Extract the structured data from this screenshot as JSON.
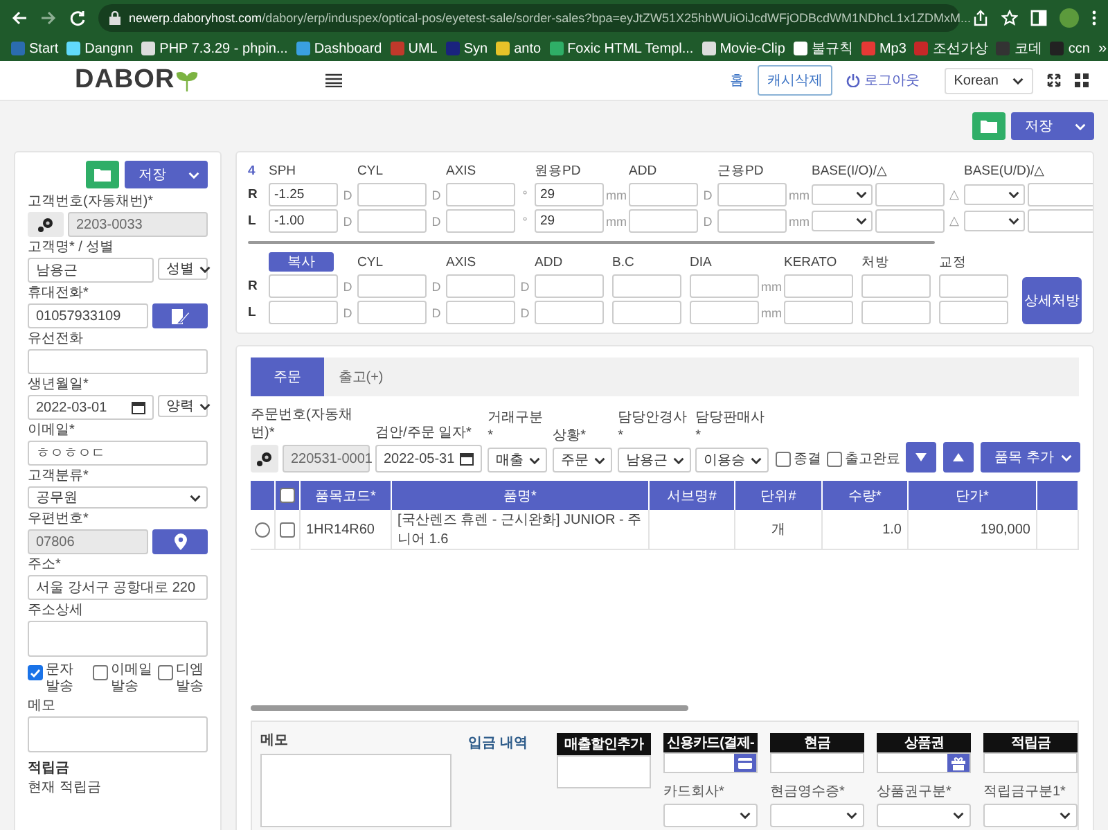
{
  "browser": {
    "url_host": "newerp.daboryhost.com",
    "url_path": "/dabory/erp/induspex/optical-pos/eyetest-sale/sorder-sales?bpa=eyJtZW51X25hbWUiOiJcdWFjODBcdWM1NDhcL1x1ZDMxM...",
    "bookmarks": [
      "Start",
      "Dangnn",
      "PHP 7.3.29 - phpin...",
      "Dashboard",
      "UML",
      "Syn",
      "anto",
      "Foxic HTML Templ...",
      "Movie-Clip",
      "불규칙",
      "Mp3",
      "조선가상",
      "코데",
      "ccn"
    ],
    "more": "»"
  },
  "header": {
    "logo": "DABOR",
    "home": "홈",
    "cache_button": "캐시삭제",
    "logout": "로그아웃",
    "language": "Korean"
  },
  "toolbar": {
    "save": "저장"
  },
  "customer": {
    "save": "저장",
    "fields": [
      {
        "kind": "addon",
        "label": "고객번호(자동채번)*",
        "value": "2203-0033",
        "disabled": true
      },
      {
        "kind": "input-select",
        "label": "고객명* / 성별",
        "value": "남용근",
        "select": "성별",
        "disabled": false
      },
      {
        "kind": "input-edit",
        "label": "휴대전화*",
        "value": "01057933109",
        "disabled": false
      },
      {
        "kind": "input",
        "label": "유선전화",
        "disabled": false
      },
      {
        "kind": "date-select",
        "label": "생년월일*",
        "value": "2022-03-01",
        "select": "양력",
        "disabled": false
      },
      {
        "kind": "input",
        "label": "이메일*",
        "value": "ㅎㅇㅎㅇㄷ",
        "disabled": false
      },
      {
        "kind": "select",
        "label": "고객분류*",
        "value": "공무원",
        "disabled": false
      },
      {
        "kind": "input-pin",
        "label": "우편번호*",
        "value": "07806",
        "disabled": true
      },
      {
        "kind": "input",
        "label": "주소*",
        "value": "서울 강서구 공항대로 220",
        "disabled": false
      },
      {
        "kind": "textarea",
        "label": "주소상세",
        "disabled": false
      }
    ],
    "notify": [
      {
        "label": "문자 발송",
        "checked": true
      },
      {
        "label": "이메일 발송",
        "checked": false
      },
      {
        "label": "디엠 발송",
        "checked": false
      }
    ],
    "memo_label": "메모",
    "points_title": "적립금",
    "points_label": "현재 적립금"
  },
  "rx": {
    "index": "4",
    "eyes": [
      "R",
      "L"
    ],
    "far": [
      {
        "kind": "input",
        "label": "SPH",
        "units": [
          "D",
          "D"
        ],
        "r": "-1.25",
        "l": "-1.00"
      },
      {
        "kind": "input",
        "label": "CYL",
        "units": [
          "D",
          "D"
        ]
      },
      {
        "kind": "input",
        "label": "AXIS",
        "units": [
          "°",
          "°"
        ]
      },
      {
        "kind": "input",
        "label": "원용PD",
        "units": [
          "mm",
          "mm"
        ],
        "r": "29",
        "l": "29"
      },
      {
        "kind": "input",
        "label": "ADD",
        "units": [
          "D",
          "D"
        ]
      },
      {
        "kind": "input",
        "label": "근용PD",
        "units": [
          "mm",
          "mm"
        ]
      },
      {
        "kind": "select-input",
        "label": "BASE(I/O)/△",
        "units": [
          "△",
          "△"
        ]
      },
      {
        "kind": "select-input",
        "label": "BASE(U/D)/△"
      }
    ],
    "copy_button": "복사",
    "near_eyes": [
      "R",
      "L"
    ],
    "near": [
      {
        "kind": "input",
        "units": [
          "D",
          "D"
        ]
      },
      {
        "kind": "input",
        "label": "CYL",
        "units": [
          "D",
          "D"
        ]
      },
      {
        "kind": "input",
        "label": "AXIS",
        "units": [
          "D",
          "D"
        ]
      },
      {
        "kind": "input",
        "label": "ADD"
      },
      {
        "kind": "input",
        "label": "B.C"
      },
      {
        "kind": "input",
        "label": "DIA",
        "units": [
          "mm",
          "mm"
        ]
      },
      {
        "kind": "input",
        "label": "KERATO"
      },
      {
        "kind": "input",
        "label": "처방"
      },
      {
        "kind": "input",
        "label": "교정"
      }
    ],
    "detail_button": "상세처방"
  },
  "order": {
    "tabs": [
      {
        "label": "주문",
        "selected": true
      },
      {
        "label": "출고(+)",
        "selected": false
      }
    ],
    "fields": [
      {
        "kind": "addon",
        "label": "주문번호(자동채번)*",
        "value": "220531-0001",
        "disabled": true
      },
      {
        "kind": "date",
        "label": "검안/주문 일자*",
        "value": "2022-05-31",
        "disabled": false
      },
      {
        "kind": "select",
        "label": "거래구분*",
        "value": "매출",
        "disabled": false
      },
      {
        "kind": "select",
        "label": "상황*",
        "value": "주문",
        "disabled": false
      },
      {
        "kind": "select",
        "label": "담당안경사 *",
        "value": "남용근",
        "disabled": false
      },
      {
        "kind": "select",
        "label": "담당판매사 *",
        "value": "이용승",
        "disabled": false
      }
    ],
    "flags": [
      {
        "label": "종결",
        "checked": false
      },
      {
        "label": "출고완료",
        "checked": false
      }
    ],
    "add_button": "품목 추가",
    "table": {
      "all_checked": false,
      "columns": [
        "품목코드*",
        "품명*",
        "서브명#",
        "단위#",
        "수량*",
        "단가*"
      ],
      "rows": [
        {
          "selected": false,
          "checked": false,
          "cells": [
            "1HR14R60",
            "[국산렌즈 휴렌 - 근시완화] JUNIOR - 주니어 1.6",
            "",
            "개",
            "1.0",
            "190,000"
          ]
        }
      ]
    }
  },
  "payment": {
    "memo_label": "메모",
    "deposit_label": "입금 내역",
    "methods": [
      {
        "kind": "plain",
        "label": "매출할인추가"
      },
      {
        "kind": "card",
        "label": "신용카드(결제-",
        "field_label": "카드회사*"
      },
      {
        "kind": "plain",
        "label": "현금",
        "field_label": "현금영수증*"
      },
      {
        "kind": "gift",
        "label": "상품권",
        "field_label": "상품권구분*"
      },
      {
        "kind": "plain",
        "label": "적립금",
        "field_label": "적립금구분1*"
      }
    ]
  }
}
